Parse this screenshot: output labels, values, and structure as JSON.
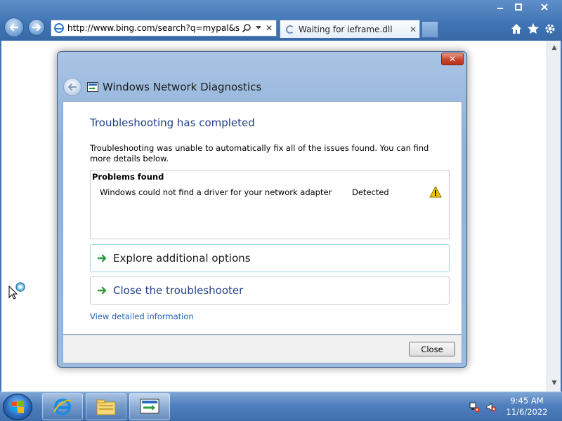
{
  "browser": {
    "url": "http://www.bing.com/search?q=mypal&src=i",
    "tab_title": "Waiting for ieframe.dll",
    "tab_close": "✕",
    "address_close": "✕"
  },
  "dialog": {
    "title": "Windows Network Diagnostics",
    "close_glyph": "✕",
    "heading": "Troubleshooting has completed",
    "description": "Troubleshooting was unable to automatically fix all of the issues found. You can find more details below.",
    "problems": {
      "title": "Problems found",
      "items": [
        {
          "text": "Windows could not find a driver for your network adapter",
          "status": "Detected",
          "icon": "warning-icon"
        }
      ]
    },
    "options": [
      {
        "label": "Explore additional options",
        "icon": "green-arrow-icon"
      },
      {
        "label": "Close the troubleshooter",
        "icon": "green-arrow-icon"
      }
    ],
    "detail_link": "View detailed information",
    "close_button": "Close"
  },
  "taskbar": {
    "time": "9:45 AM",
    "date": "11/6/2022",
    "pinned": [
      "internet-explorer-icon",
      "windows-explorer-icon",
      "network-diagnostics-icon"
    ]
  },
  "colors": {
    "heading": "#1f3f8a",
    "link": "#1f5fb5",
    "arrow": "#2e9e3c",
    "warning": "#f5c400"
  }
}
